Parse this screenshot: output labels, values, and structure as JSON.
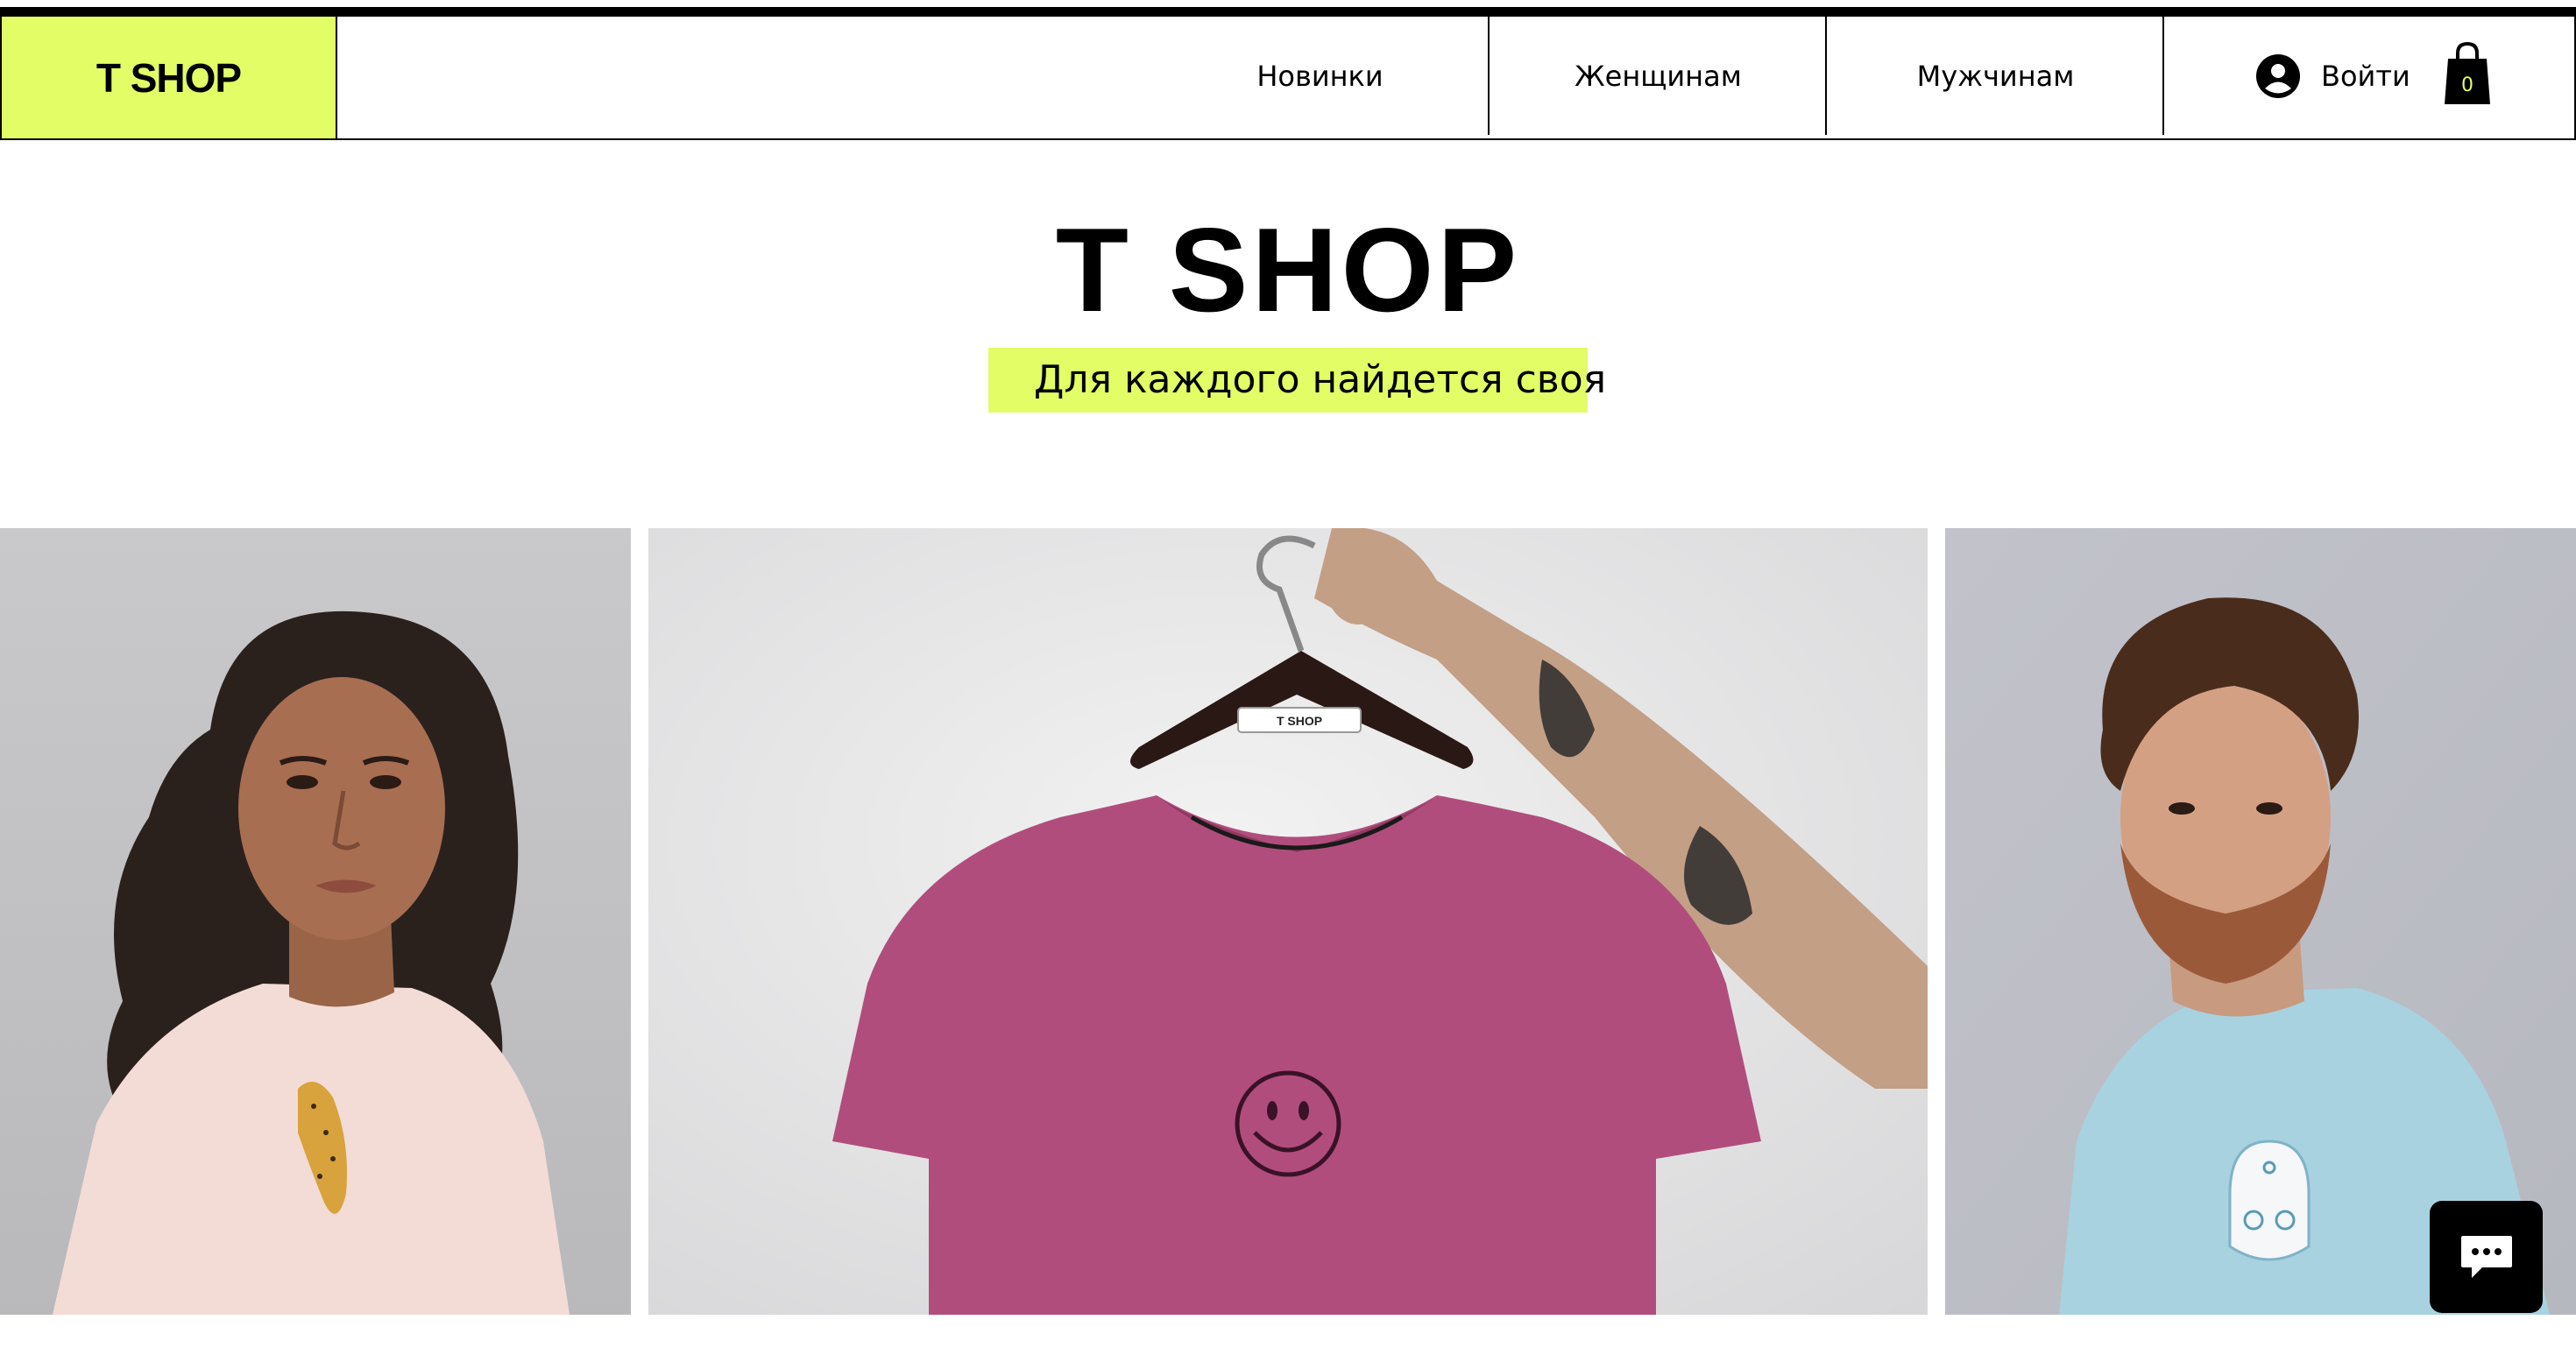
{
  "header": {
    "logo": "T SHOP",
    "nav": [
      "Новинки",
      "Женщинам",
      "Мужчинам"
    ],
    "login_label": "Войти",
    "cart_count": "0"
  },
  "hero": {
    "title": "T SHOP",
    "tagline": "Для каждого найдется своя",
    "accent_color": "#e2fd66"
  },
  "photos": {
    "left": {
      "label_icon": "woman-pink-tee-cheetah-print"
    },
    "center": {
      "tag_text": "T SHOP",
      "label_icon": "magenta-tee-on-hanger-smiley"
    },
    "right": {
      "label_icon": "man-blue-tee-bike-badge"
    }
  },
  "chat": {
    "icon": "chat-bubble-icon"
  }
}
